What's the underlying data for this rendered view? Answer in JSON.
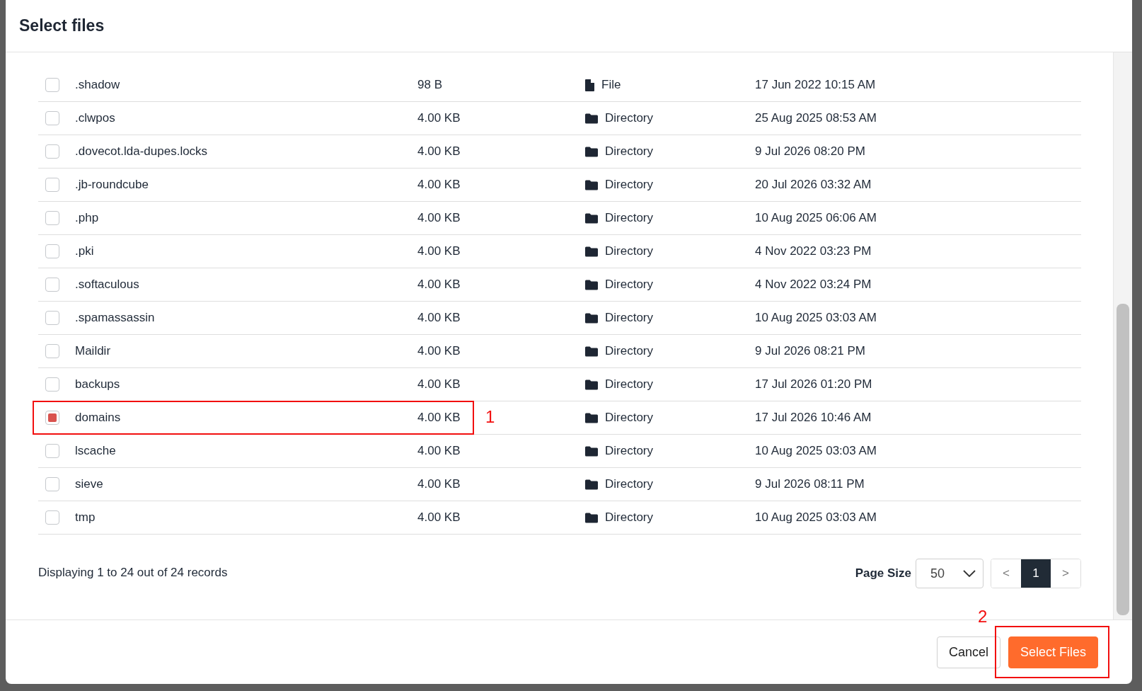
{
  "dialog": {
    "title": "Select files"
  },
  "rows": [
    {
      "name": ".shadow",
      "size": "98 B",
      "kind": "file",
      "type": "File",
      "modified": "17 Jun 2022 10:15 AM",
      "checked": false
    },
    {
      "name": ".clwpos",
      "size": "4.00 KB",
      "kind": "directory",
      "type": "Directory",
      "modified": "25 Aug 2025 08:53 AM",
      "checked": false
    },
    {
      "name": ".dovecot.lda-dupes.locks",
      "size": "4.00 KB",
      "kind": "directory",
      "type": "Directory",
      "modified": "9 Jul 2026 08:20 PM",
      "checked": false
    },
    {
      "name": ".jb-roundcube",
      "size": "4.00 KB",
      "kind": "directory",
      "type": "Directory",
      "modified": "20 Jul 2026 03:32 AM",
      "checked": false
    },
    {
      "name": ".php",
      "size": "4.00 KB",
      "kind": "directory",
      "type": "Directory",
      "modified": "10 Aug 2025 06:06 AM",
      "checked": false
    },
    {
      "name": ".pki",
      "size": "4.00 KB",
      "kind": "directory",
      "type": "Directory",
      "modified": "4 Nov 2022 03:23 PM",
      "checked": false
    },
    {
      "name": ".softaculous",
      "size": "4.00 KB",
      "kind": "directory",
      "type": "Directory",
      "modified": "4 Nov 2022 03:24 PM",
      "checked": false
    },
    {
      "name": ".spamassassin",
      "size": "4.00 KB",
      "kind": "directory",
      "type": "Directory",
      "modified": "10 Aug 2025 03:03 AM",
      "checked": false
    },
    {
      "name": "Maildir",
      "size": "4.00 KB",
      "kind": "directory",
      "type": "Directory",
      "modified": "9 Jul 2026 08:21 PM",
      "checked": false
    },
    {
      "name": "backups",
      "size": "4.00 KB",
      "kind": "directory",
      "type": "Directory",
      "modified": "17 Jul 2026 01:20 PM",
      "checked": false
    },
    {
      "name": "domains",
      "size": "4.00 KB",
      "kind": "directory",
      "type": "Directory",
      "modified": "17 Jul 2026 10:46 AM",
      "checked": true,
      "annotation": "1"
    },
    {
      "name": "lscache",
      "size": "4.00 KB",
      "kind": "directory",
      "type": "Directory",
      "modified": "10 Aug 2025 03:03 AM",
      "checked": false
    },
    {
      "name": "sieve",
      "size": "4.00 KB",
      "kind": "directory",
      "type": "Directory",
      "modified": "9 Jul 2026 08:11 PM",
      "checked": false
    },
    {
      "name": "tmp",
      "size": "4.00 KB",
      "kind": "directory",
      "type": "Directory",
      "modified": "10 Aug 2025 03:03 AM",
      "checked": false
    }
  ],
  "summary": "Displaying 1 to 24 out of 24 records",
  "pager": {
    "page_size_label": "Page Size",
    "page_size": "50",
    "prev": "<",
    "pages": [
      {
        "label": "1",
        "selected": true
      }
    ],
    "next": ">"
  },
  "buttons": {
    "cancel": "Cancel",
    "confirm": "Select Files",
    "confirm_annotation": "2"
  }
}
